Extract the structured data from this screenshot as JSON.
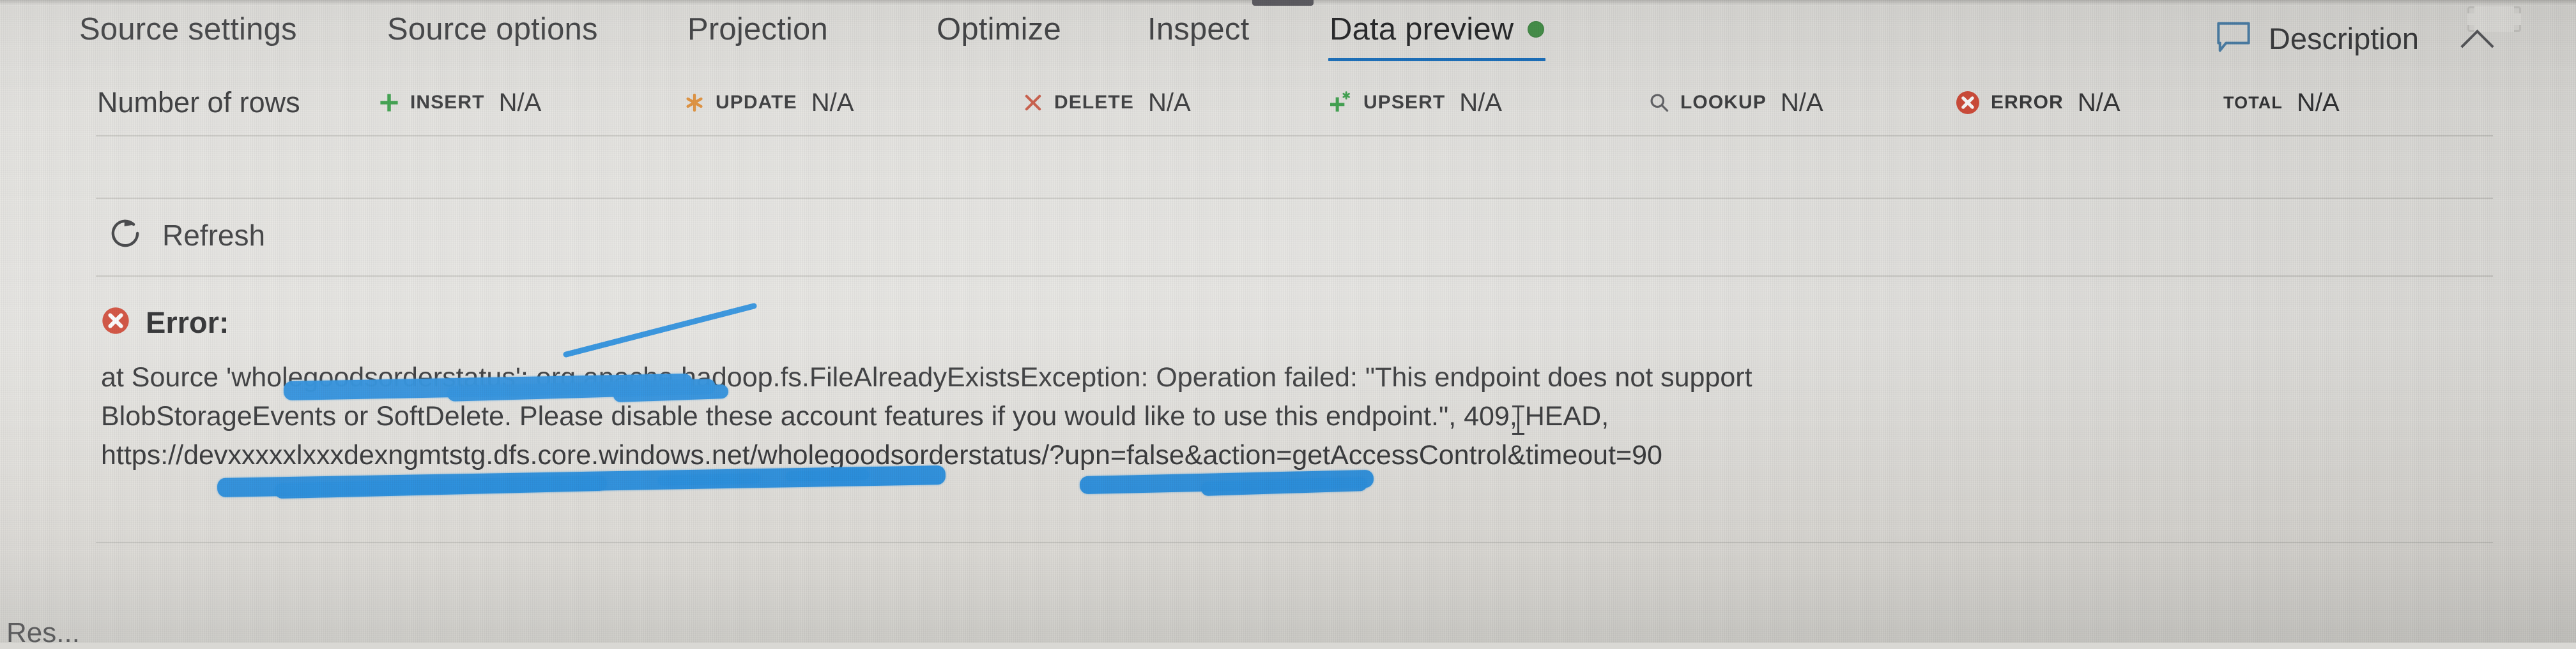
{
  "window": {
    "corner_icon": "restore-window-icon",
    "drag_handle": "window-drag-handle"
  },
  "tabs": [
    {
      "id": "source-settings",
      "label": "Source settings",
      "active": false
    },
    {
      "id": "source-options",
      "label": "Source options",
      "active": false
    },
    {
      "id": "projection",
      "label": "Projection",
      "active": false
    },
    {
      "id": "optimize",
      "label": "Optimize",
      "active": false
    },
    {
      "id": "inspect",
      "label": "Inspect",
      "active": false
    },
    {
      "id": "data-preview",
      "label": "Data preview",
      "active": true,
      "status_dot": "#3b8a3f"
    }
  ],
  "header": {
    "description_label": "Description",
    "description_icon": "comment-icon",
    "collapse_icon": "chevron-up-icon"
  },
  "metrics": {
    "title": "Number of rows",
    "items": [
      {
        "id": "insert",
        "icon": "plus-icon",
        "icon_color": "#2e9b3f",
        "label": "INSERT",
        "value": "N/A"
      },
      {
        "id": "update",
        "icon": "asterisk-icon",
        "icon_color": "#e08a2e",
        "label": "UPDATE",
        "value": "N/A"
      },
      {
        "id": "delete",
        "icon": "x-icon",
        "icon_color": "#c8503a",
        "label": "DELETE",
        "value": "N/A"
      },
      {
        "id": "upsert",
        "icon": "plus-asterisk-icon",
        "icon_color": "#2e9b3f",
        "label": "UPSERT",
        "value": "N/A"
      },
      {
        "id": "lookup",
        "icon": "magnifier-icon",
        "icon_color": "#55565a",
        "label": "LOOKUP",
        "value": "N/A"
      },
      {
        "id": "error",
        "icon": "error-circle-icon",
        "icon_color": "#d0402c",
        "label": "ERROR",
        "value": "N/A"
      },
      {
        "id": "total",
        "icon": "none",
        "icon_color": "#2d2e30",
        "label": "TOTAL",
        "value": "N/A"
      }
    ]
  },
  "toolbar": {
    "refresh_label": "Refresh",
    "refresh_icon": "refresh-icon"
  },
  "error": {
    "heading": "Error:",
    "heading_icon": "error-circle-icon",
    "lines": [
      "at Source 'wholegoodsorderstatus': org.apache.hadoop.fs.FileAlreadyExistsException: Operation failed: \"This endpoint does not support",
      "BlobStorageEvents or SoftDelete. Please disable these account features if you would like to use this endpoint.\", 409, HEAD,",
      "https://devxxxxxlxxxdexngmtstg.dfs.core.windows.net/wholegoodsorderstatus/?upn=false&action=getAccessControl&timeout=90"
    ]
  },
  "footer": {
    "partial_label": "Res..."
  },
  "colors": {
    "accent": "#0a66b8",
    "ok": "#3b8a3f",
    "error": "#d0402c",
    "warn": "#e08a2e",
    "redaction": "#1e8ade",
    "background": "#e6e5e1"
  }
}
